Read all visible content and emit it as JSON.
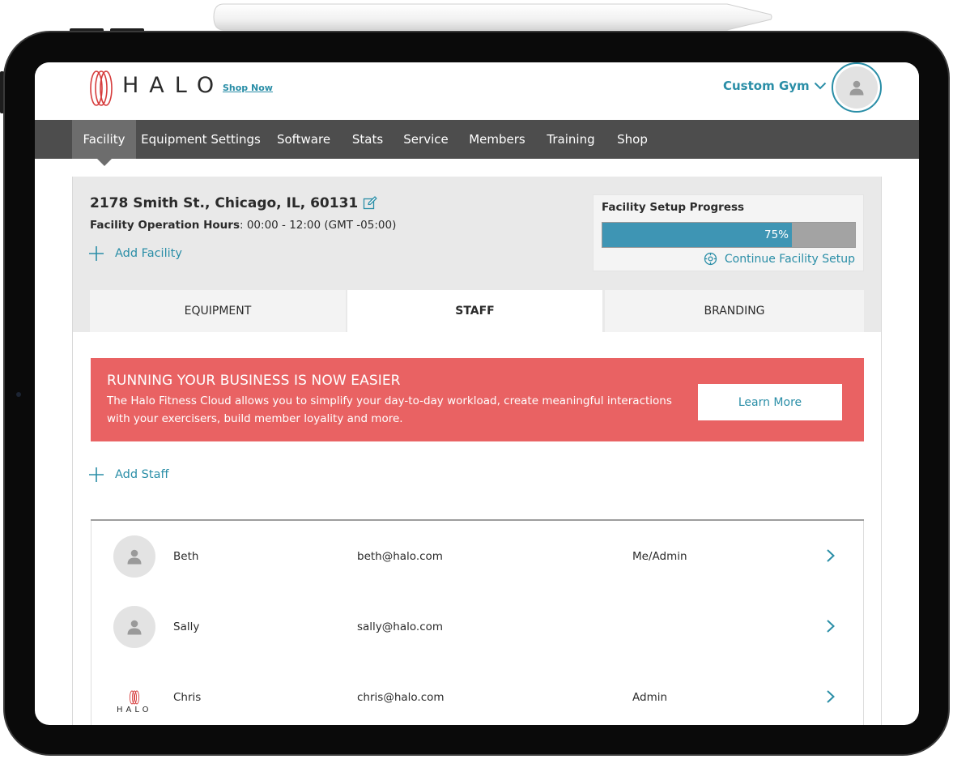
{
  "brand": {
    "logo_text": "HALO",
    "shop_now": "Shop Now"
  },
  "header": {
    "gym_name": "Custom Gym"
  },
  "nav": {
    "items": [
      "Facility",
      "Equipment Settings",
      "Software",
      "Stats",
      "Service",
      "Members",
      "Training",
      "Shop"
    ],
    "active": "Facility"
  },
  "facility": {
    "address": "2178 Smith St., Chicago, IL, 60131",
    "hours_label": "Facility Operation Hours",
    "hours_value": ": 00:00 - 12:00 (GMT -05:00)",
    "add_facility": "Add Facility"
  },
  "progress": {
    "title": "Facility Setup Progress",
    "percent": 75,
    "percent_label": "75%",
    "continue_label": "Continue Facility Setup"
  },
  "tabs": {
    "items": [
      "EQUIPMENT",
      "STAFF",
      "BRANDING"
    ],
    "active": "STAFF"
  },
  "banner": {
    "title": "RUNNING YOUR BUSINESS IS NOW EASIER",
    "text": "The Halo Fitness Cloud allows you to simplify your day-to-day workload, create meaningful interactions with your exercisers, build member loyality and more.",
    "button": "Learn More"
  },
  "staff": {
    "add_label": "Add Staff",
    "rows": [
      {
        "name": "Beth",
        "email": "beth@halo.com",
        "role": "Me/Admin",
        "avatar": "person-icon"
      },
      {
        "name": "Sally",
        "email": "sally@halo.com",
        "role": "",
        "avatar": "person-icon"
      },
      {
        "name": "Chris",
        "email": "chris@halo.com",
        "role": "Admin",
        "avatar": "halo-logo"
      }
    ]
  },
  "colors": {
    "accent": "#2a8ea7",
    "nav_bg": "#4d4d4d",
    "nav_active": "#6d6d6d",
    "banner_bg": "#e96263",
    "progress_fill": "#3e95b4",
    "logo_red": "#d63c3c"
  }
}
